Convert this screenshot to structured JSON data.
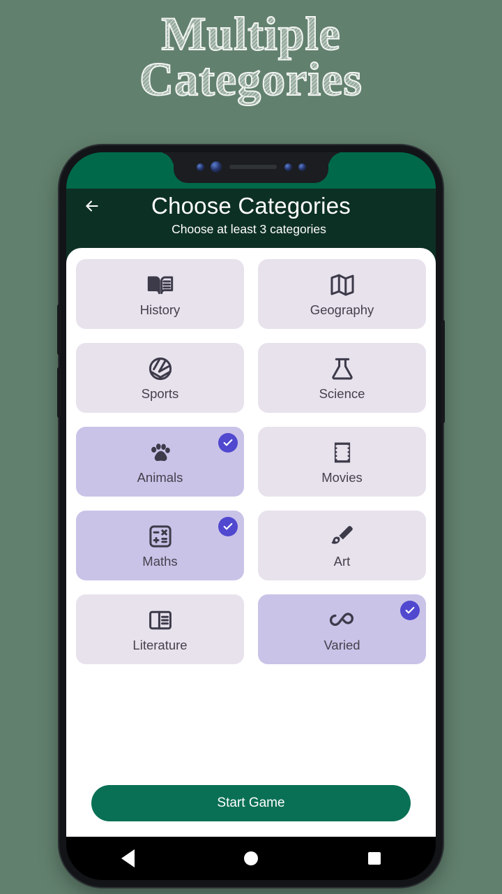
{
  "promo": {
    "line1": "Multiple",
    "line2": "Categories"
  },
  "phone": {
    "statusbar_color": "#00694a",
    "appbar_color": "#0d3024"
  },
  "appbar": {
    "back_icon": "arrow-left-icon",
    "title": "Choose Categories",
    "subtitle": "Choose at least 3 categories"
  },
  "categories": [
    {
      "label": "History",
      "icon": "open-book-icon",
      "selected": false
    },
    {
      "label": "Geography",
      "icon": "folded-map-icon",
      "selected": false
    },
    {
      "label": "Sports",
      "icon": "volleyball-icon",
      "selected": false
    },
    {
      "label": "Science",
      "icon": "flask-icon",
      "selected": false
    },
    {
      "label": "Animals",
      "icon": "paw-print-icon",
      "selected": true
    },
    {
      "label": "Movies",
      "icon": "film-strip-icon",
      "selected": false
    },
    {
      "label": "Maths",
      "icon": "calculator-icon",
      "selected": true
    },
    {
      "label": "Art",
      "icon": "paintbrush-icon",
      "selected": false
    },
    {
      "label": "Literature",
      "icon": "article-icon",
      "selected": false
    },
    {
      "label": "Varied",
      "icon": "infinity-icon",
      "selected": true
    }
  ],
  "cta": {
    "label": "Start Game",
    "color": "#0a7055"
  },
  "navbar": {
    "back": "triangle-back-icon",
    "home": "circle-home-icon",
    "recents": "square-recents-icon"
  },
  "colors": {
    "page_background": "#62806e",
    "card_unselected": "#e7e2ec",
    "card_selected": "#cac3e8",
    "check_badge": "#5048cf",
    "icon": "#3d3a4a"
  }
}
